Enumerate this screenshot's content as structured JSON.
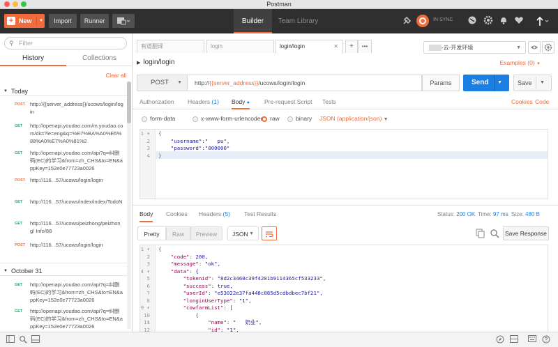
{
  "window": {
    "title": "Postman"
  },
  "toolbar": {
    "new_label": "New",
    "import_label": "Import",
    "runner_label": "Runner",
    "modes": [
      "Builder",
      "Team Library"
    ],
    "sync_label": "IN SYNC"
  },
  "sidebar": {
    "filter_placeholder": "Filter",
    "tabs": [
      "History",
      "Collections"
    ],
    "clear_all": "Clear all",
    "groups": [
      {
        "label": "Today",
        "items": [
          {
            "method": "POST",
            "url": "http://{{server_address}}/ucows/login/login"
          },
          {
            "method": "GET",
            "url": "http://openapi.youdao.com/m.youdao.com/dict?le=eng&q=%E7%BA%A0%E5%88%A0%E7%A0%81%2"
          },
          {
            "method": "GET",
            "url": "http://openapi.youdao.com/api?q=纠删码(EC)的学习&from=zh_CHS&to=EN&appKey=152e0e77723a0026"
          },
          {
            "method": "POST",
            "url": "http://116.   .57/ucows/login/login"
          },
          {
            "method": "GET",
            "url": "http://116.   .57/ucows/index/index/TodoN"
          },
          {
            "method": "GET",
            "url": "http://116.   .57/ucows/peizhong/peizhong/   Info/88"
          },
          {
            "method": "POST",
            "url": "http://116.   .57/ucows/login/login"
          }
        ]
      },
      {
        "label": "October 31",
        "items": [
          {
            "method": "GET",
            "url": "http://openapi.youdao.com/api?q=纠删码(EC)的学习&from=zh_CHS&to=EN&appKey=152e0e77723a0026"
          },
          {
            "method": "GET",
            "url": "http://openapi.youdao.com/api?q=纠删码(EC)的学习&from=zh_CHS&to=EN&appKey=152e0e77723a0026"
          }
        ]
      }
    ]
  },
  "request_tabs": [
    "有道翻译",
    "login",
    "login/login"
  ],
  "environment": "-云-开发环境",
  "request": {
    "name": "login/login",
    "examples_label": "Examples (0)",
    "method": "POST",
    "url_prefix": "http://",
    "url_var": "{{server_address}}",
    "url_path": "/ucows/login/login",
    "params_label": "Params",
    "send_label": "Send",
    "save_label": "Save",
    "subtabs": [
      "Authorization",
      "Headers",
      "Body",
      "Pre-request Script",
      "Tests"
    ],
    "headers_count": "(1)",
    "cookies_label": "Cookies",
    "code_label": "Code",
    "body_modes": [
      "form-data",
      "x-www-form-urlencoded",
      "raw",
      "binary"
    ],
    "body_type": "JSON (application/json)",
    "body_lines": [
      "{",
      "    \"username\":\"   pu\",",
      "    \"password\":\"000000\"",
      "}"
    ]
  },
  "response": {
    "tabs": [
      "Body",
      "Cookies",
      "Headers",
      "Test Results"
    ],
    "headers_count": "(5)",
    "status_label": "Status:",
    "status_value": "200 OK",
    "time_label": "Time:",
    "time_value": "97 ms",
    "size_label": "Size:",
    "size_value": "480 B",
    "views": [
      "Pretty",
      "Raw",
      "Preview"
    ],
    "format": "JSON",
    "save_response": "Save Response",
    "lines": [
      "{",
      "    \"code\": 200,",
      "    \"message\": \"ok\",",
      "    \"data\": {",
      "        \"tokenid\": \"8d2c3460c39f4201b9114365cf533233\",",
      "        \"success\": true,",
      "        \"userId\": \"e53022e37fa448c085d5cdbdbec7bf21\",",
      "        \"longinUserType\": \"1\",",
      "        \"cowfarmList\": [",
      "            {",
      "                \"name\": \"   奶业\",",
      "                \"id\": \"1\","
    ]
  }
}
